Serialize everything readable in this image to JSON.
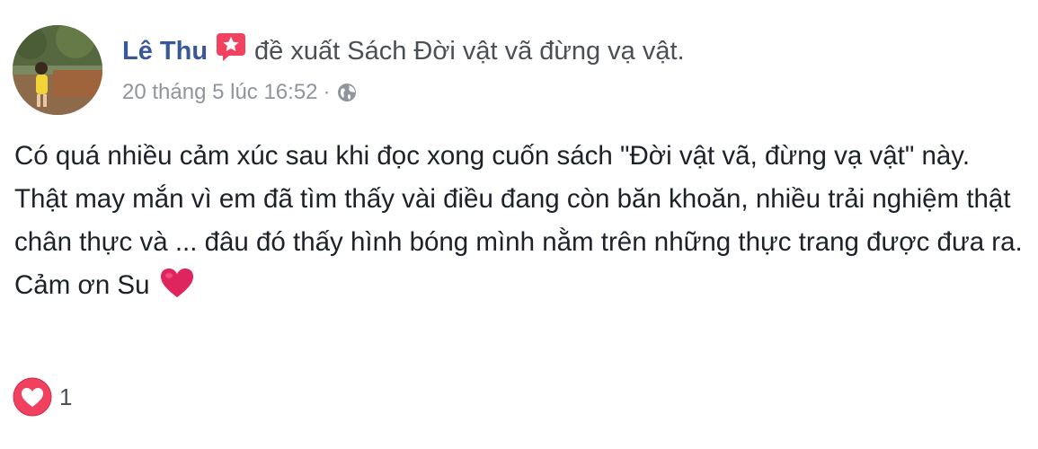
{
  "post": {
    "author": "Lê Thu",
    "action": "đề xuất",
    "book_title": "Sách Đời vật vã đừng vạ vật.",
    "timestamp": "20 tháng 5 lúc 16:52",
    "separator": "·",
    "privacy_icon": "globe-icon",
    "body": "Có quá nhiều cảm xúc sau khi đọc xong cuốn sách \"Đời vật vã, đừng vạ vật\" này. Thật may mắn vì em đã tìm thấy vài điều đang còn băn khoăn, nhiều trải nghiệm thật chân thực và ... đâu đó thấy hình bóng mình nằm trên những thực trang được đưa ra. Cảm ơn Su",
    "body_emoji": "red-heart-icon",
    "reaction_icon": "love-reaction-icon",
    "reaction_count": "1"
  },
  "colors": {
    "author": "#385898",
    "text": "#1d2129",
    "meta": "#90949c",
    "recommend_badge": "#f3425f",
    "heart": "#e0245e"
  }
}
